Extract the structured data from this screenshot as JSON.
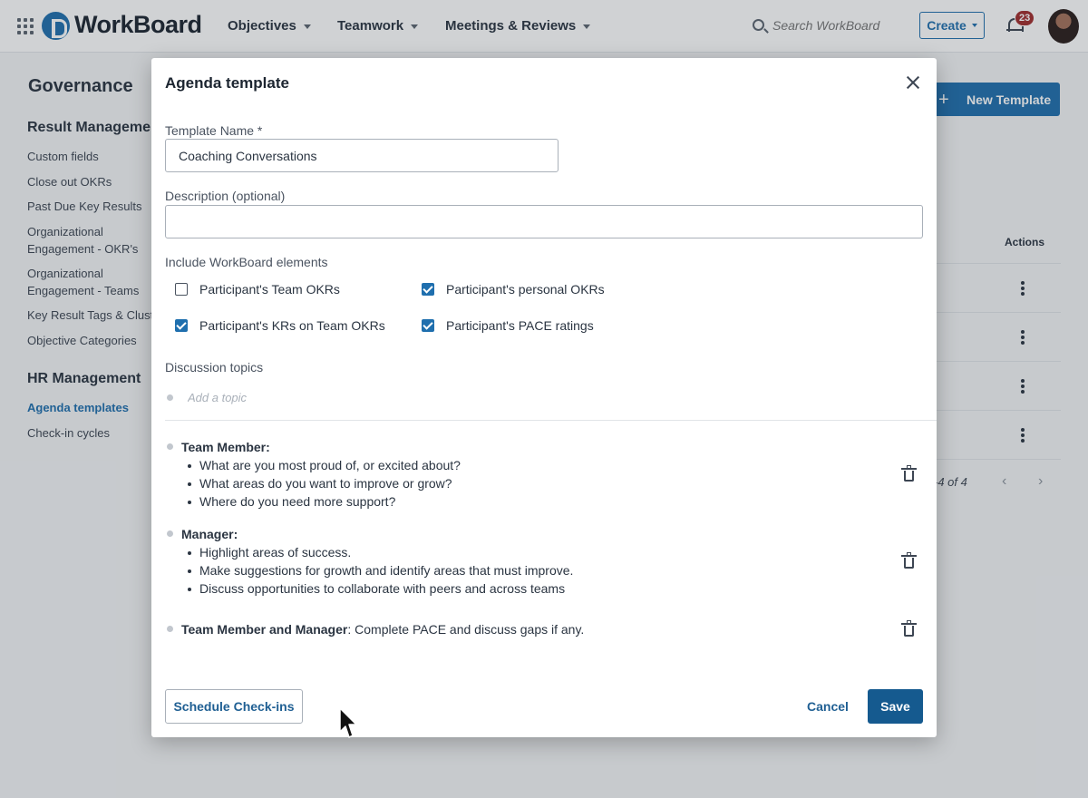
{
  "topbar": {
    "brand": "WorkBoard",
    "nav": [
      {
        "label": "Objectives"
      },
      {
        "label": "Teamwork"
      },
      {
        "label": "Meetings & Reviews"
      }
    ],
    "search_placeholder": "Search WorkBoard",
    "create_label": "Create",
    "notification_count": "23"
  },
  "sidebar": {
    "title": "Governance",
    "sections": [
      {
        "heading": "Result Management",
        "items": [
          "Custom fields",
          "Close out OKRs",
          "Past Due Key Results",
          "Organizational Engagement - OKR's",
          "Organizational Engagement - Teams",
          "Key Result Tags & Clusters",
          "Objective Categories"
        ]
      },
      {
        "heading": "HR Management",
        "items": [
          "Agenda templates",
          "Check-in cycles"
        ]
      }
    ],
    "active_item": "Agenda templates"
  },
  "page": {
    "new_template_label": "New Template",
    "actions_header": "Actions",
    "pagination_text": "-4 of 4"
  },
  "modal": {
    "title": "Agenda template",
    "template_name_label": "Template Name *",
    "template_name_value": "Coaching Conversations",
    "description_label": "Description (optional)",
    "description_value": "",
    "elements_label": "Include WorkBoard elements",
    "elements": [
      {
        "label": "Participant's Team OKRs",
        "checked": false
      },
      {
        "label": "Participant's personal OKRs",
        "checked": true
      },
      {
        "label": "Participant's KRs on Team OKRs",
        "checked": true
      },
      {
        "label": "Participant's PACE ratings",
        "checked": true
      }
    ],
    "topics_label": "Discussion topics",
    "topic_placeholder": "Add a topic",
    "topics": [
      {
        "title": "Team Member:",
        "rest": "",
        "bullets": [
          "What are you most proud of, or excited about?",
          "What areas do you want to improve or grow?",
          "Where do you need more support?"
        ]
      },
      {
        "title": "Manager:",
        "rest": "",
        "bullets": [
          "Highlight areas of success.",
          "Make suggestions for growth and identify areas that must improve.",
          "Discuss opportunities to collaborate with peers and across teams"
        ]
      },
      {
        "title": "Team Member and Manager",
        "rest": ": Complete PACE and discuss gaps if any.",
        "bullets": []
      }
    ],
    "schedule_label": "Schedule Check-ins",
    "cancel_label": "Cancel",
    "save_label": "Save"
  },
  "colors": {
    "accent": "#1f6fae",
    "save_button": "#155a8f",
    "badge": "#a12c2c"
  }
}
